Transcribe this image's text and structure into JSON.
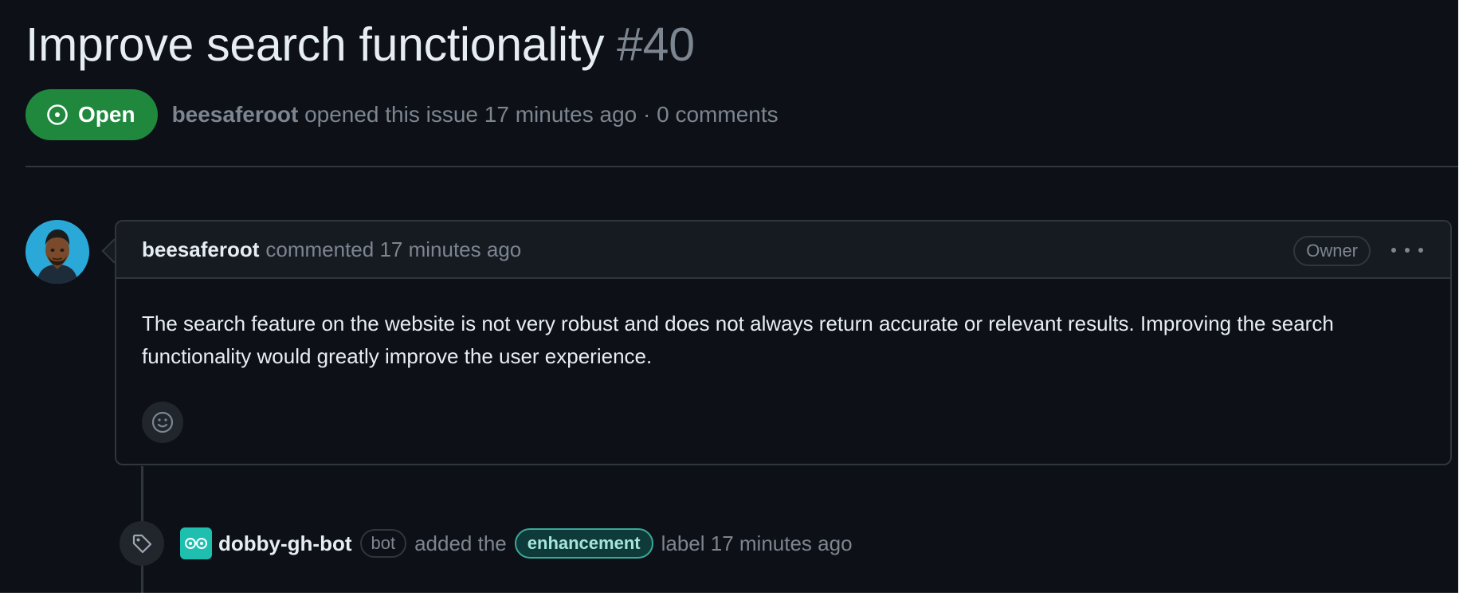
{
  "issue": {
    "title": "Improve search functionality",
    "number": "#40",
    "state": "Open",
    "author": "beesaferoot",
    "meta": "opened this issue 17 minutes ago · 0 comments"
  },
  "comment": {
    "author": "beesaferoot",
    "action": "commented 17 minutes ago",
    "role_badge": "Owner",
    "body": "The search feature on the website is not very robust and does not always return accurate or relevant results. Improving the search functionality would greatly improve the user experience."
  },
  "event": {
    "actor": "dobby-gh-bot",
    "actor_badge": "bot",
    "text_before": "added the",
    "label": "enhancement",
    "text_after": "label 17 minutes ago"
  },
  "colors": {
    "background": "#0d1117",
    "open_badge": "#1f883d",
    "label_border": "#3aa99a",
    "muted": "#7d8590"
  }
}
